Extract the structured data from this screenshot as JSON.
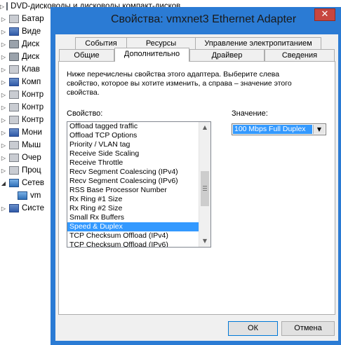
{
  "tree": {
    "items": [
      {
        "label": "DVD-дисководы и дисководы компакт-дисков",
        "icon": "dvd-drive-icon",
        "expanded": false
      },
      {
        "label": "Батар",
        "icon": "battery-icon",
        "expanded": false
      },
      {
        "label": "Виде",
        "icon": "display-adapter-icon",
        "expanded": false
      },
      {
        "label": "Диск",
        "icon": "disk-drive-icon",
        "expanded": false
      },
      {
        "label": "Диск",
        "icon": "disk-drive-icon",
        "expanded": false
      },
      {
        "label": "Клав",
        "icon": "keyboard-icon",
        "expanded": false
      },
      {
        "label": "Комп",
        "icon": "computer-icon",
        "expanded": false
      },
      {
        "label": "Контр",
        "icon": "controller-icon",
        "expanded": false
      },
      {
        "label": "Контр",
        "icon": "controller-icon",
        "expanded": false
      },
      {
        "label": "Контр",
        "icon": "controller-icon",
        "expanded": false
      },
      {
        "label": "Мони",
        "icon": "monitor-icon",
        "expanded": false
      },
      {
        "label": "Мыш",
        "icon": "mouse-icon",
        "expanded": false
      },
      {
        "label": "Очер",
        "icon": "print-queue-icon",
        "expanded": false
      },
      {
        "label": "Проц",
        "icon": "processor-icon",
        "expanded": false
      },
      {
        "label": "Сетев",
        "icon": "network-adapter-icon",
        "expanded": true
      },
      {
        "label": "vm",
        "icon": "network-card-icon",
        "expanded": false,
        "child": true
      },
      {
        "label": "Систе",
        "icon": "system-device-icon",
        "expanded": false
      }
    ]
  },
  "dialog": {
    "title": "Свойства: vmxnet3 Ethernet Adapter",
    "close_label": "✕",
    "tabs_back": [
      "События",
      "Ресурсы",
      "Управление электропитанием"
    ],
    "tabs_front": [
      "Общие",
      "Дополнительно",
      "Драйвер",
      "Сведения"
    ],
    "active_tab": "Дополнительно",
    "description": "Ниже перечислены свойства этого адаптера. Выберите слева свойство, которое вы хотите изменить, а справа – значение этого свойства.",
    "property_label": "Свойство:",
    "value_label": "Значение:",
    "properties": [
      "Offload tagged traffic",
      "Offload TCP Options",
      "Priority / VLAN tag",
      "Receive Side Scaling",
      "Receive Throttle",
      "Recv Segment Coalescing (IPv4)",
      "Recv Segment Coalescing (IPv6)",
      "RSS Base Processor Number",
      "Rx Ring #1 Size",
      "Rx Ring #2 Size",
      "Small Rx Buffers",
      "Speed & Duplex",
      "TCP Checksum Offload (IPv4)",
      "TCP Checksum Offload (IPv6)"
    ],
    "selected_property": "Speed & Duplex",
    "value_selected": "100 Mbps Full Duplex",
    "ok_label": "ОК",
    "cancel_label": "Отмена",
    "colors": {
      "title_bar": "#2b7bd4",
      "selection": "#3399ff",
      "close_button": "#c7463f"
    }
  }
}
